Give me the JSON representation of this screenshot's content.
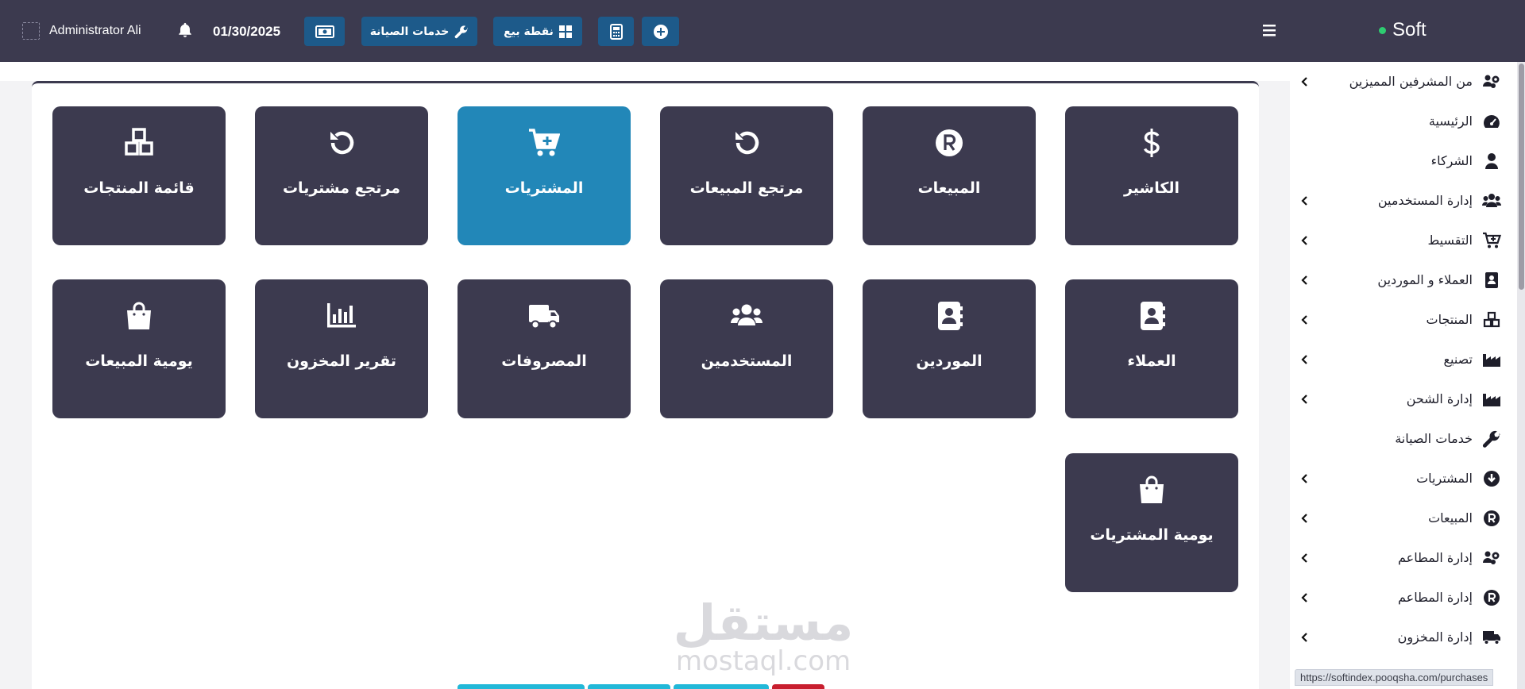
{
  "topbar": {
    "user_name": "Administrator Ali",
    "date": "01/30/2025",
    "buttons": {
      "maintenance": "خدمات الصيانة",
      "pos": "نقطة بيع"
    }
  },
  "brand": {
    "name": "Soft"
  },
  "sidebar": {
    "items": [
      {
        "label": "من المشرفين المميزين",
        "icon": "users-cog-icon",
        "chevron": true
      },
      {
        "label": "الرئيسية",
        "icon": "gauge-icon",
        "chevron": false
      },
      {
        "label": "الشركاء",
        "icon": "user-icon",
        "chevron": false
      },
      {
        "label": "إدارة المستخدمين",
        "icon": "users-icon",
        "chevron": true
      },
      {
        "label": "التقسيط",
        "icon": "cart-plus-icon",
        "chevron": true
      },
      {
        "label": "العملاء و الموردين",
        "icon": "contact-card-icon",
        "chevron": true
      },
      {
        "label": "المنتجات",
        "icon": "cubes-icon",
        "chevron": true
      },
      {
        "label": "تصنيع",
        "icon": "industry-icon",
        "chevron": true
      },
      {
        "label": "إدارة الشحن",
        "icon": "industry-icon",
        "chevron": true
      },
      {
        "label": "خدمات الصيانة",
        "icon": "wrench-icon",
        "chevron": false
      },
      {
        "label": "المشتريات",
        "icon": "arrow-circle-down-icon",
        "chevron": true
      },
      {
        "label": "المبيعات",
        "icon": "r-circle-icon",
        "chevron": true
      },
      {
        "label": "إدارة المطاعم",
        "icon": "users-cog-icon",
        "chevron": true
      },
      {
        "label": "إدارة المطاعم",
        "icon": "r-circle-icon",
        "chevron": true
      },
      {
        "label": "إدارة المخزون",
        "icon": "truck-icon",
        "chevron": true
      }
    ]
  },
  "tiles": [
    {
      "label": "الكاشير",
      "icon": "dollar-icon"
    },
    {
      "label": "المبيعات",
      "icon": "r-circle-icon"
    },
    {
      "label": "مرتجع المبيعات",
      "icon": "undo-icon"
    },
    {
      "label": "المشتريات",
      "icon": "cart-plus-icon",
      "active": true
    },
    {
      "label": "مرتجع مشتريات",
      "icon": "undo-icon"
    },
    {
      "label": "قائمة المنتجات",
      "icon": "cubes-icon"
    },
    {
      "label": "العملاء",
      "icon": "contact-book-icon"
    },
    {
      "label": "الموردين",
      "icon": "contact-book-icon"
    },
    {
      "label": "المستخدمين",
      "icon": "users-icon"
    },
    {
      "label": "المصروفات",
      "icon": "truck-icon"
    },
    {
      "label": "تقرير المخزون",
      "icon": "chart-bar-icon"
    },
    {
      "label": "يومية المبيعات",
      "icon": "shopping-bag-icon"
    },
    {
      "label": "يومية المشتريات",
      "icon": "shopping-bag-icon"
    }
  ],
  "watermark": {
    "arabic": "مستقل",
    "latin": "mostaql.com"
  },
  "status_url": "https://softindex.pooqsha.com/purchases",
  "colors": {
    "topbar": "#3c3a4f",
    "tile": "#3c3a4f",
    "tile_active": "#2287b8",
    "toolbar_button": "#1d5a8a",
    "online_dot": "#2ecc71"
  }
}
